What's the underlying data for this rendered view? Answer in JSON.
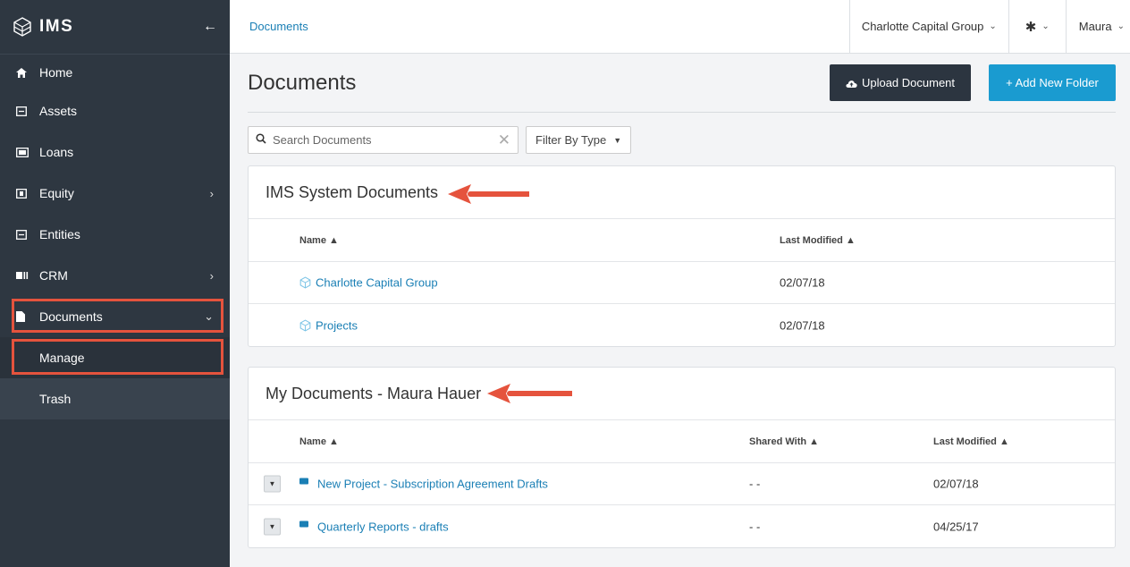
{
  "app": {
    "name": "IMS"
  },
  "sidebar": {
    "items": [
      {
        "label": "Home"
      },
      {
        "label": "Assets"
      },
      {
        "label": "Loans"
      },
      {
        "label": "Equity"
      },
      {
        "label": "Entities"
      },
      {
        "label": "CRM"
      },
      {
        "label": "Documents"
      }
    ],
    "sub_items": [
      {
        "label": "Manage"
      },
      {
        "label": "Trash"
      }
    ]
  },
  "topbar": {
    "breadcrumb": "Documents",
    "organization": "Charlotte Capital Group",
    "user": "Maura"
  },
  "page": {
    "title": "Documents",
    "upload_label": "Upload Document",
    "add_folder_label": "+ Add New Folder",
    "search_placeholder": "Search Documents",
    "filter_label": "Filter By Type"
  },
  "system_docs": {
    "title": "IMS System Documents",
    "headers": {
      "name": "Name",
      "last_modified": "Last Modified"
    },
    "rows": [
      {
        "name": "Charlotte Capital Group",
        "modified": "02/07/18"
      },
      {
        "name": "Projects",
        "modified": "02/07/18"
      }
    ]
  },
  "my_docs": {
    "title": "My Documents - Maura Hauer",
    "headers": {
      "name": "Name",
      "shared_with": "Shared With",
      "last_modified": "Last Modified"
    },
    "rows": [
      {
        "name": "New Project - Subscription Agreement Drafts",
        "shared": "- -",
        "modified": "02/07/18"
      },
      {
        "name": "Quarterly Reports - drafts",
        "shared": "- -",
        "modified": "04/25/17"
      }
    ]
  },
  "colors": {
    "accent": "#1a9bd0",
    "link": "#1a7fb5",
    "sidebar": "#2e3741",
    "highlight": "#e5533d"
  }
}
